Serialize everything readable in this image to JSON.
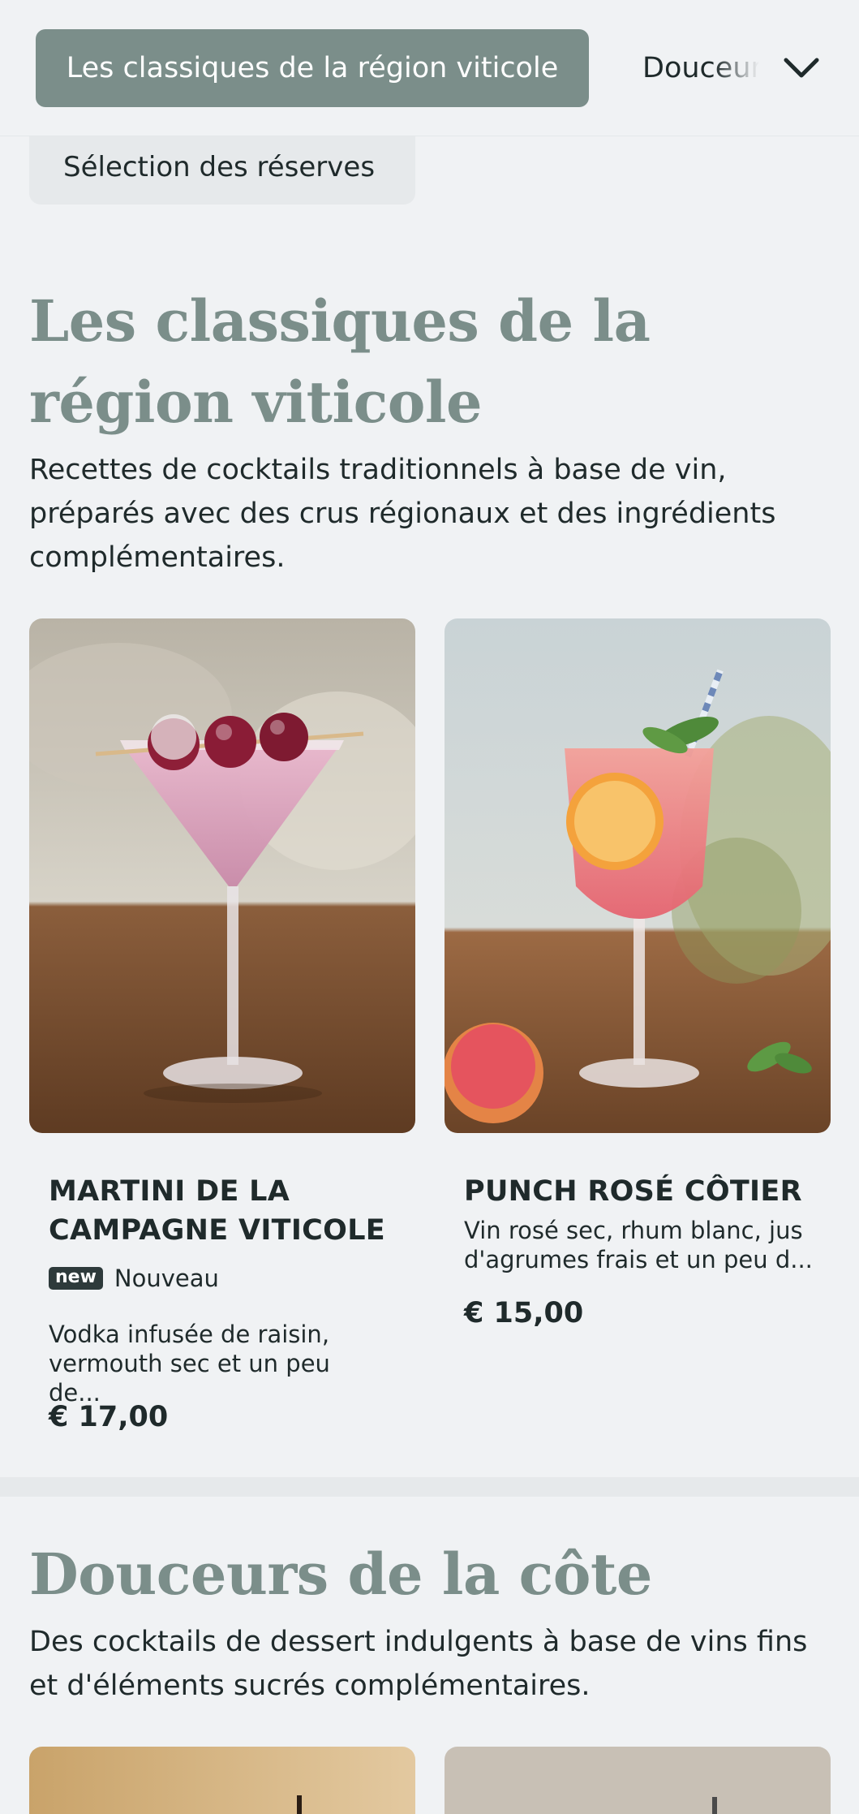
{
  "nav": {
    "active_category": "Les classiques de la région viticole",
    "next_category": "Douceurs de la côte",
    "partial_category": "Sélection des réserves",
    "dropdown_icon": "chevron-down-icon"
  },
  "sections": [
    {
      "title": "Les classiques de la région viticole",
      "description": "Recettes de cocktails traditionnels à base de vin, préparés avec des crus régionaux et des ingrédients complémentaires.",
      "items": [
        {
          "name": "MARTINI DE LA CAMPAGNE VITICOLE",
          "badge": "new",
          "badge_label": "Nouveau",
          "description": "Vodka infusée de raisin, vermouth sec et un peu de...",
          "price": "€ 17,00"
        },
        {
          "name": "PUNCH ROSÉ CÔTIER",
          "description": "Vin rosé sec, rhum blanc, jus d'agrumes frais et un peu d...",
          "price": "€ 15,00"
        }
      ]
    },
    {
      "title": "Douceurs de la côte",
      "description": "Des cocktails de dessert indulgents à base de vins fins et d'éléments sucrés complémentaires."
    }
  ],
  "colors": {
    "accent": "#7b8e8a",
    "background": "#f0f2f4",
    "text": "#1f2a2b",
    "badge": "#2e3a3b"
  }
}
